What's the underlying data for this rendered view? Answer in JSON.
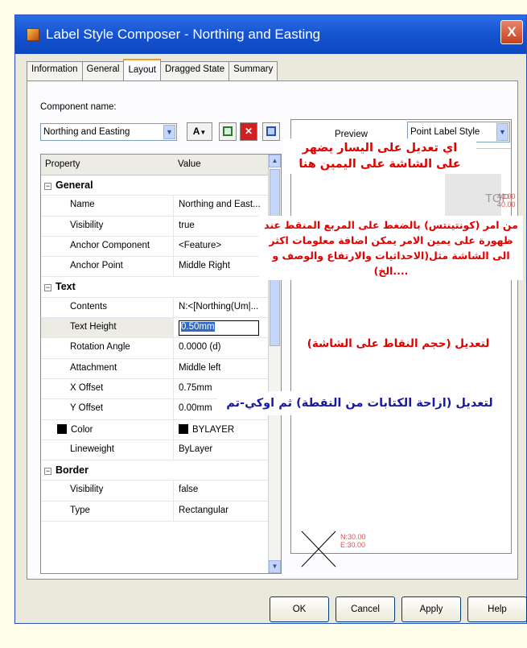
{
  "window": {
    "title": "Label Style Composer - Northing and Easting",
    "close_glyph": "X"
  },
  "tabs": [
    {
      "label": "Information"
    },
    {
      "label": "General"
    },
    {
      "label": "Layout"
    },
    {
      "label": "Dragged State"
    },
    {
      "label": "Summary"
    }
  ],
  "component": {
    "label": "Component name:",
    "value": "Northing and Easting",
    "tool_text_glyph": "A"
  },
  "grid": {
    "header_property": "Property",
    "header_value": "Value",
    "general": {
      "title": "General",
      "rows": [
        {
          "prop": "Name",
          "value": "Northing and East..."
        },
        {
          "prop": "Visibility",
          "value": "true"
        },
        {
          "prop": "Anchor Component",
          "value": "<Feature>"
        },
        {
          "prop": "Anchor Point",
          "value": "Middle Right"
        }
      ]
    },
    "text": {
      "title": "Text",
      "contents": {
        "prop": "Contents",
        "value": "N:<[Northing(Um|..."
      },
      "text_height": {
        "prop": "Text Height",
        "value": "0.50mm"
      },
      "rows": [
        {
          "prop": "Rotation Angle",
          "value": "0.0000 (d)"
        },
        {
          "prop": "Attachment",
          "value": "Middle left"
        },
        {
          "prop": "X Offset",
          "value": "0.75mm"
        },
        {
          "prop": "Y Offset",
          "value": "0.00mm"
        }
      ],
      "color": {
        "prop": "Color",
        "value": "BYLAYER"
      },
      "lineweight": {
        "prop": "Lineweight",
        "value": "ByLayer"
      }
    },
    "border": {
      "title": "Border",
      "rows": [
        {
          "prop": "Visibility",
          "value": "false"
        },
        {
          "prop": "Type",
          "value": "Rectangular"
        }
      ]
    }
  },
  "preview": {
    "label": "Preview",
    "style": "Point Label Style",
    "top_label": "TOP",
    "top_coords": [
      "40.00",
      "40.00"
    ],
    "point_coords": [
      "N:30.00",
      "E:30.00"
    ]
  },
  "buttons": {
    "ok": "OK",
    "cancel": "Cancel",
    "apply": "Apply",
    "help": "Help"
  },
  "annotations": {
    "note1": "اي تعديل على اليسار يضهر على الشاشة على اليمين هنا",
    "note2": "من امر (كونتينتس) بالضغط على المربع المنقط عند ظهورة على يمين الامر يمكن اضافة معلومات اكثر الى الشاشة مثل(الاحداثيات والارتفاع والوصف و ....الخ)",
    "note3": "لتعديل (حجم النقاط على الشاشة)",
    "note4": "لتعديل (ازاحة الكتابات من النقطة) ثم اوكي-تم"
  },
  "colors": {
    "annotation_red": "#e00000",
    "annotation_blue": "#1a1aa0",
    "preview_red": "#e05050"
  }
}
